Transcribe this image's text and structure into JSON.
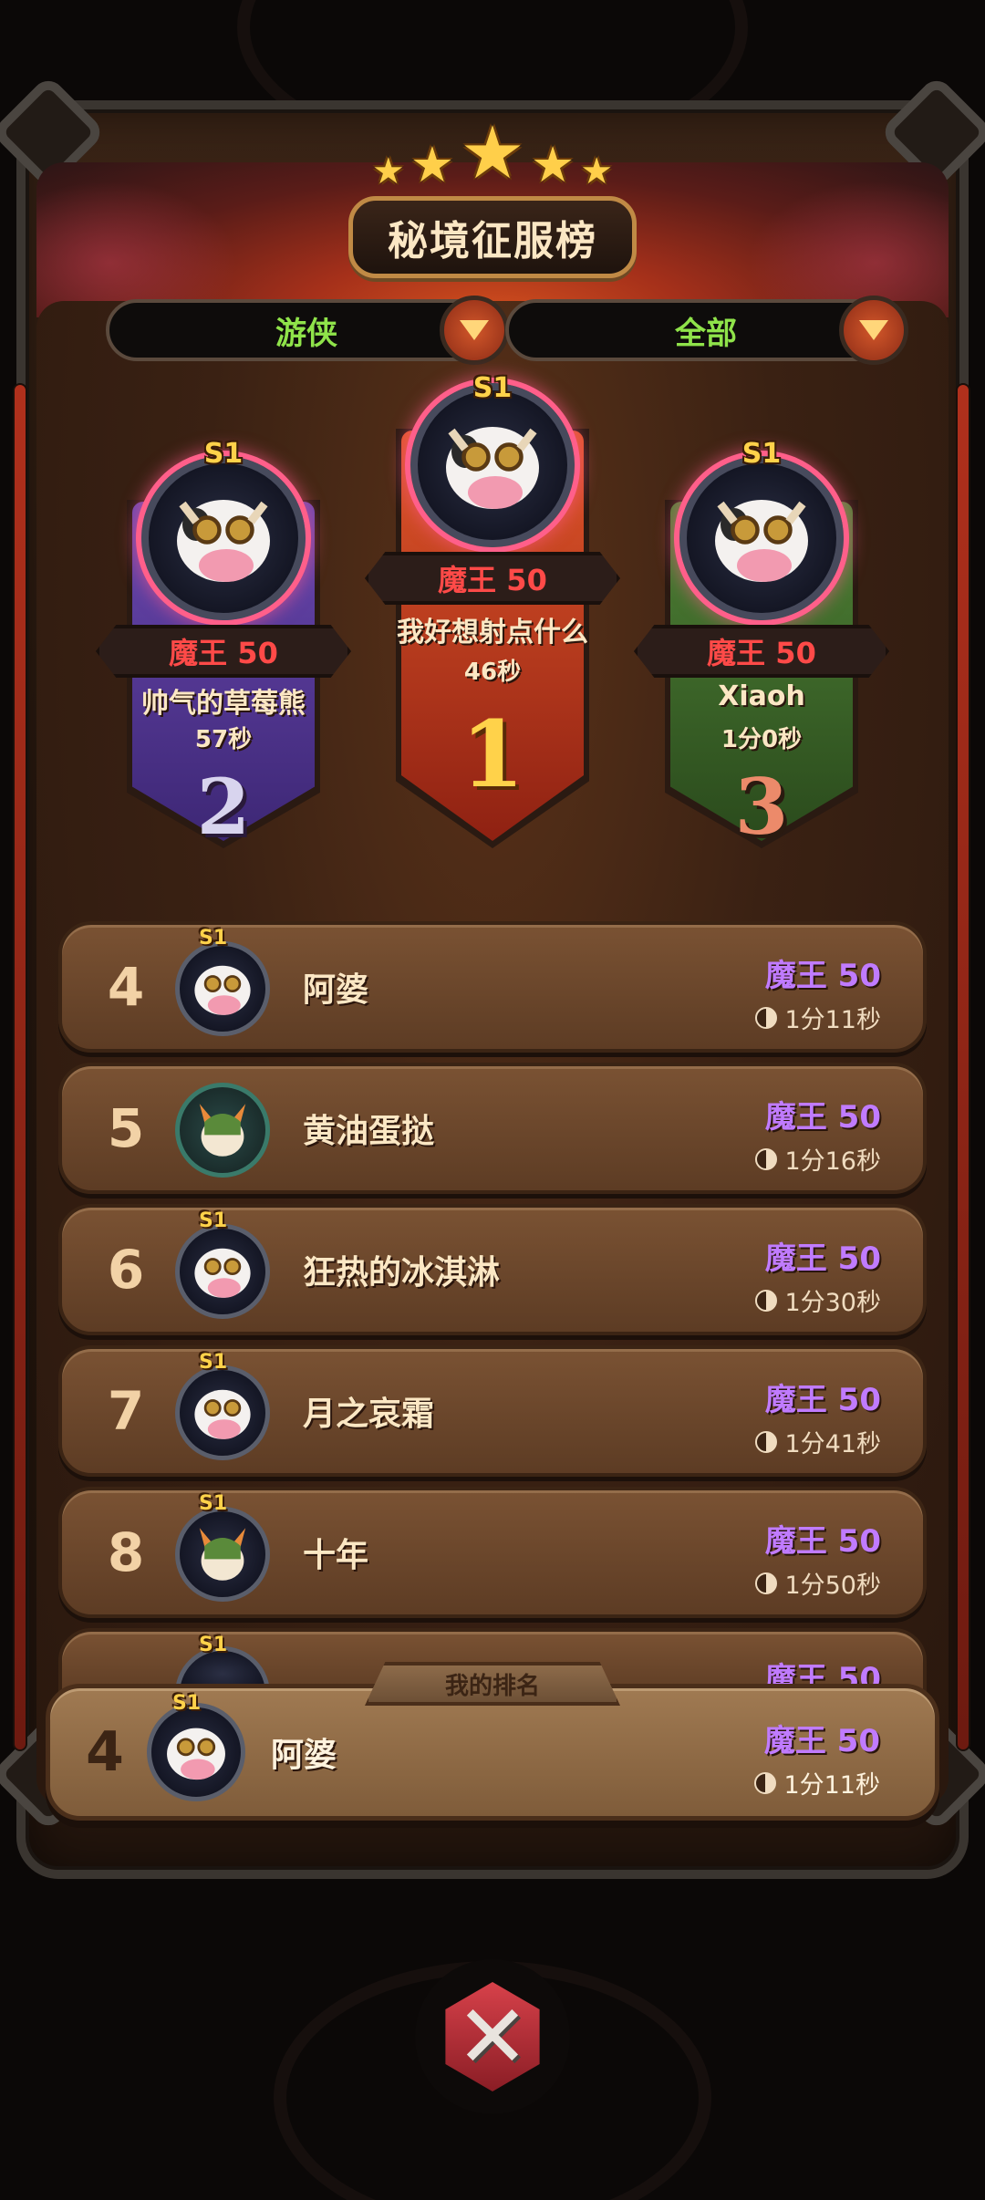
{
  "header": {
    "title": "秘境征服榜",
    "stars": "★"
  },
  "filters": {
    "class_filter": "游侠",
    "scope_filter": "全部"
  },
  "podium": [
    {
      "rank": "2",
      "season": "S1",
      "tier": "魔王 50",
      "name": "帅气的草莓熊",
      "time": "57秒",
      "color": "#5a3a9e"
    },
    {
      "rank": "1",
      "season": "S1",
      "tier": "魔王 50",
      "name": "我好想射点什么",
      "time": "46秒",
      "color": "#c8401e"
    },
    {
      "rank": "3",
      "season": "S1",
      "tier": "魔王 50",
      "name": "Xiaoh",
      "time": "1分0秒",
      "color": "#3e6a2a"
    }
  ],
  "rows": [
    {
      "rank": "4",
      "season": "S1",
      "name": "阿婆",
      "tier": "魔王 50",
      "time": "1分11秒",
      "avatar": "cow-avatar-icon"
    },
    {
      "rank": "5",
      "season": "",
      "name": "黄油蛋挞",
      "tier": "魔王 50",
      "time": "1分16秒",
      "avatar": "fox-avatar-icon"
    },
    {
      "rank": "6",
      "season": "S1",
      "name": "狂热的冰淇淋",
      "tier": "魔王 50",
      "time": "1分30秒",
      "avatar": "cow-avatar-icon"
    },
    {
      "rank": "7",
      "season": "S1",
      "name": "月之哀霜",
      "tier": "魔王 50",
      "time": "1分41秒",
      "avatar": "cow-avatar-icon"
    },
    {
      "rank": "8",
      "season": "S1",
      "name": "十年",
      "tier": "魔王 50",
      "time": "1分50秒",
      "avatar": "fox-avatar-icon"
    },
    {
      "rank": "",
      "season": "S1",
      "name": "",
      "tier": "魔王 50",
      "time": "",
      "avatar": "avatar-icon"
    }
  ],
  "my_rank": {
    "label": "我的排名",
    "rank": "4",
    "season": "S1",
    "name": "阿婆",
    "tier": "魔王 50",
    "time": "1分11秒"
  },
  "colors": {
    "tier_purple": "#c07bff",
    "tier_red": "#ff4a48",
    "filter_green": "#8fe34a",
    "gold": "#ffd24a"
  },
  "icons": {
    "close": "close-icon",
    "dropdown": "chevron-down-icon",
    "clock": "clock-icon"
  }
}
